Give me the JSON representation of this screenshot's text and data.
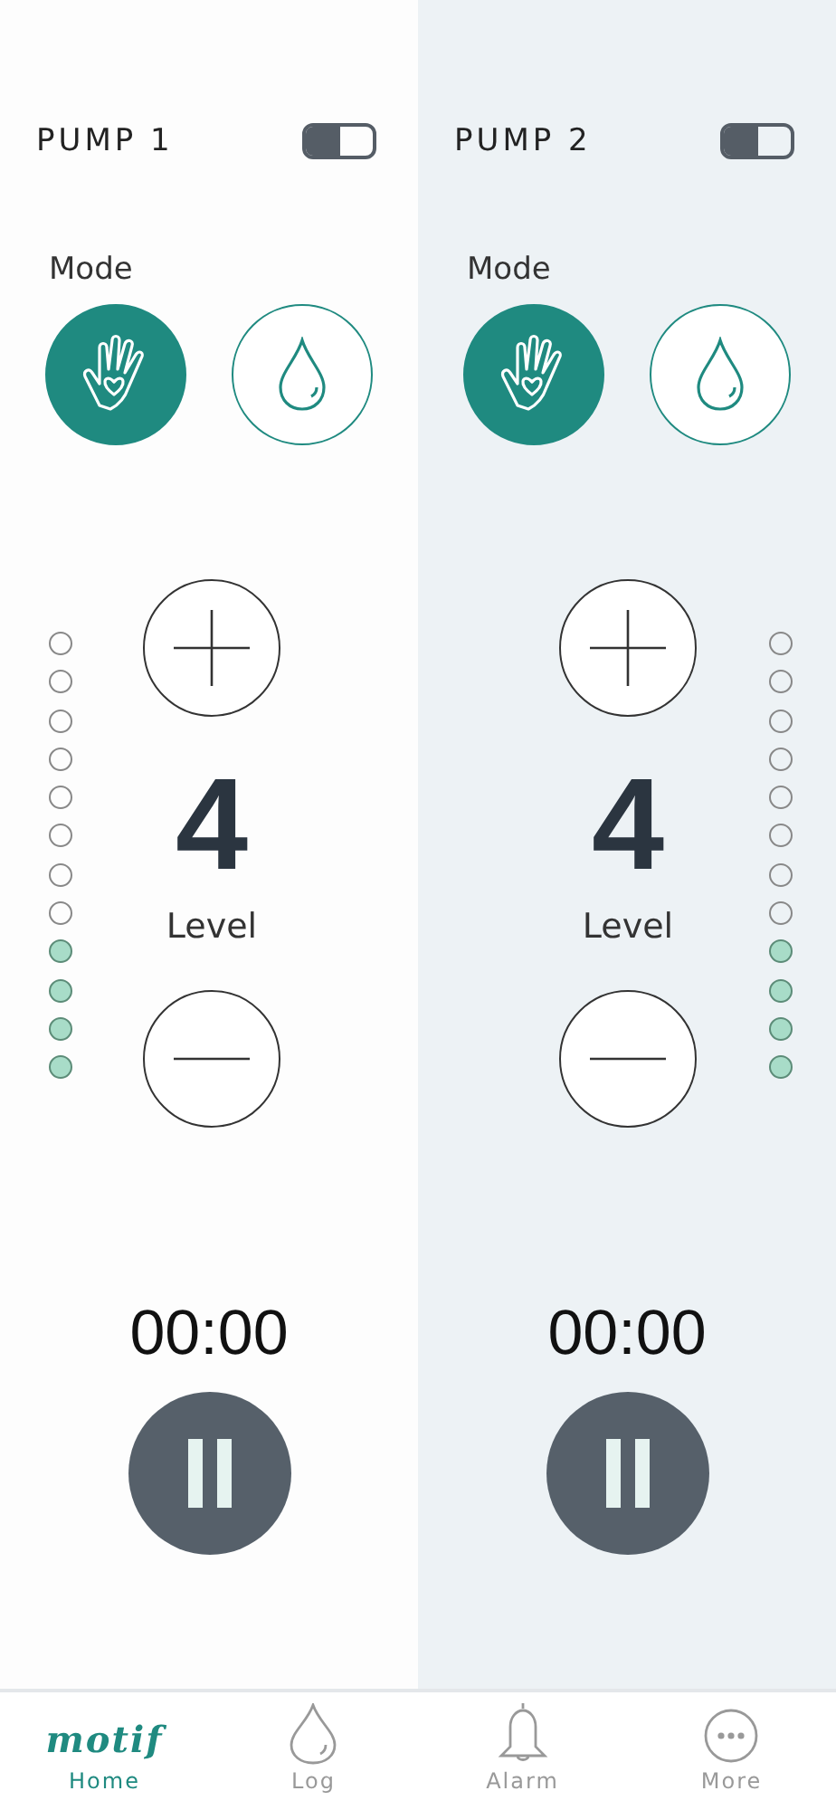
{
  "pumps": [
    {
      "title": "PUMP 1",
      "on": false,
      "mode_label": "Mode",
      "modes": [
        {
          "kind": "massage",
          "selected": true
        },
        {
          "kind": "expression",
          "selected": false
        }
      ],
      "level": 0.3333,
      "level_value": "4",
      "level_label": "Level",
      "timer": "00:00",
      "paused": true
    },
    {
      "title": "PUMP 2",
      "on": false,
      "mode_label": "Mode",
      "modes": [
        {
          "kind": "massage",
          "selected": true
        },
        {
          "kind": "expression",
          "selected": false
        }
      ],
      "level": 0.3333,
      "level_value": "4",
      "level_label": "Level",
      "timer": "00:00",
      "paused": true
    }
  ],
  "nav": [
    {
      "kind": "logo",
      "logo": "motif",
      "label": "Home",
      "selected": true
    },
    {
      "kind": "drop",
      "label": "Log",
      "selected": false
    },
    {
      "kind": "bell",
      "label": "Alarm",
      "selected": false
    },
    {
      "kind": "more",
      "label": "More",
      "selected": false
    }
  ]
}
